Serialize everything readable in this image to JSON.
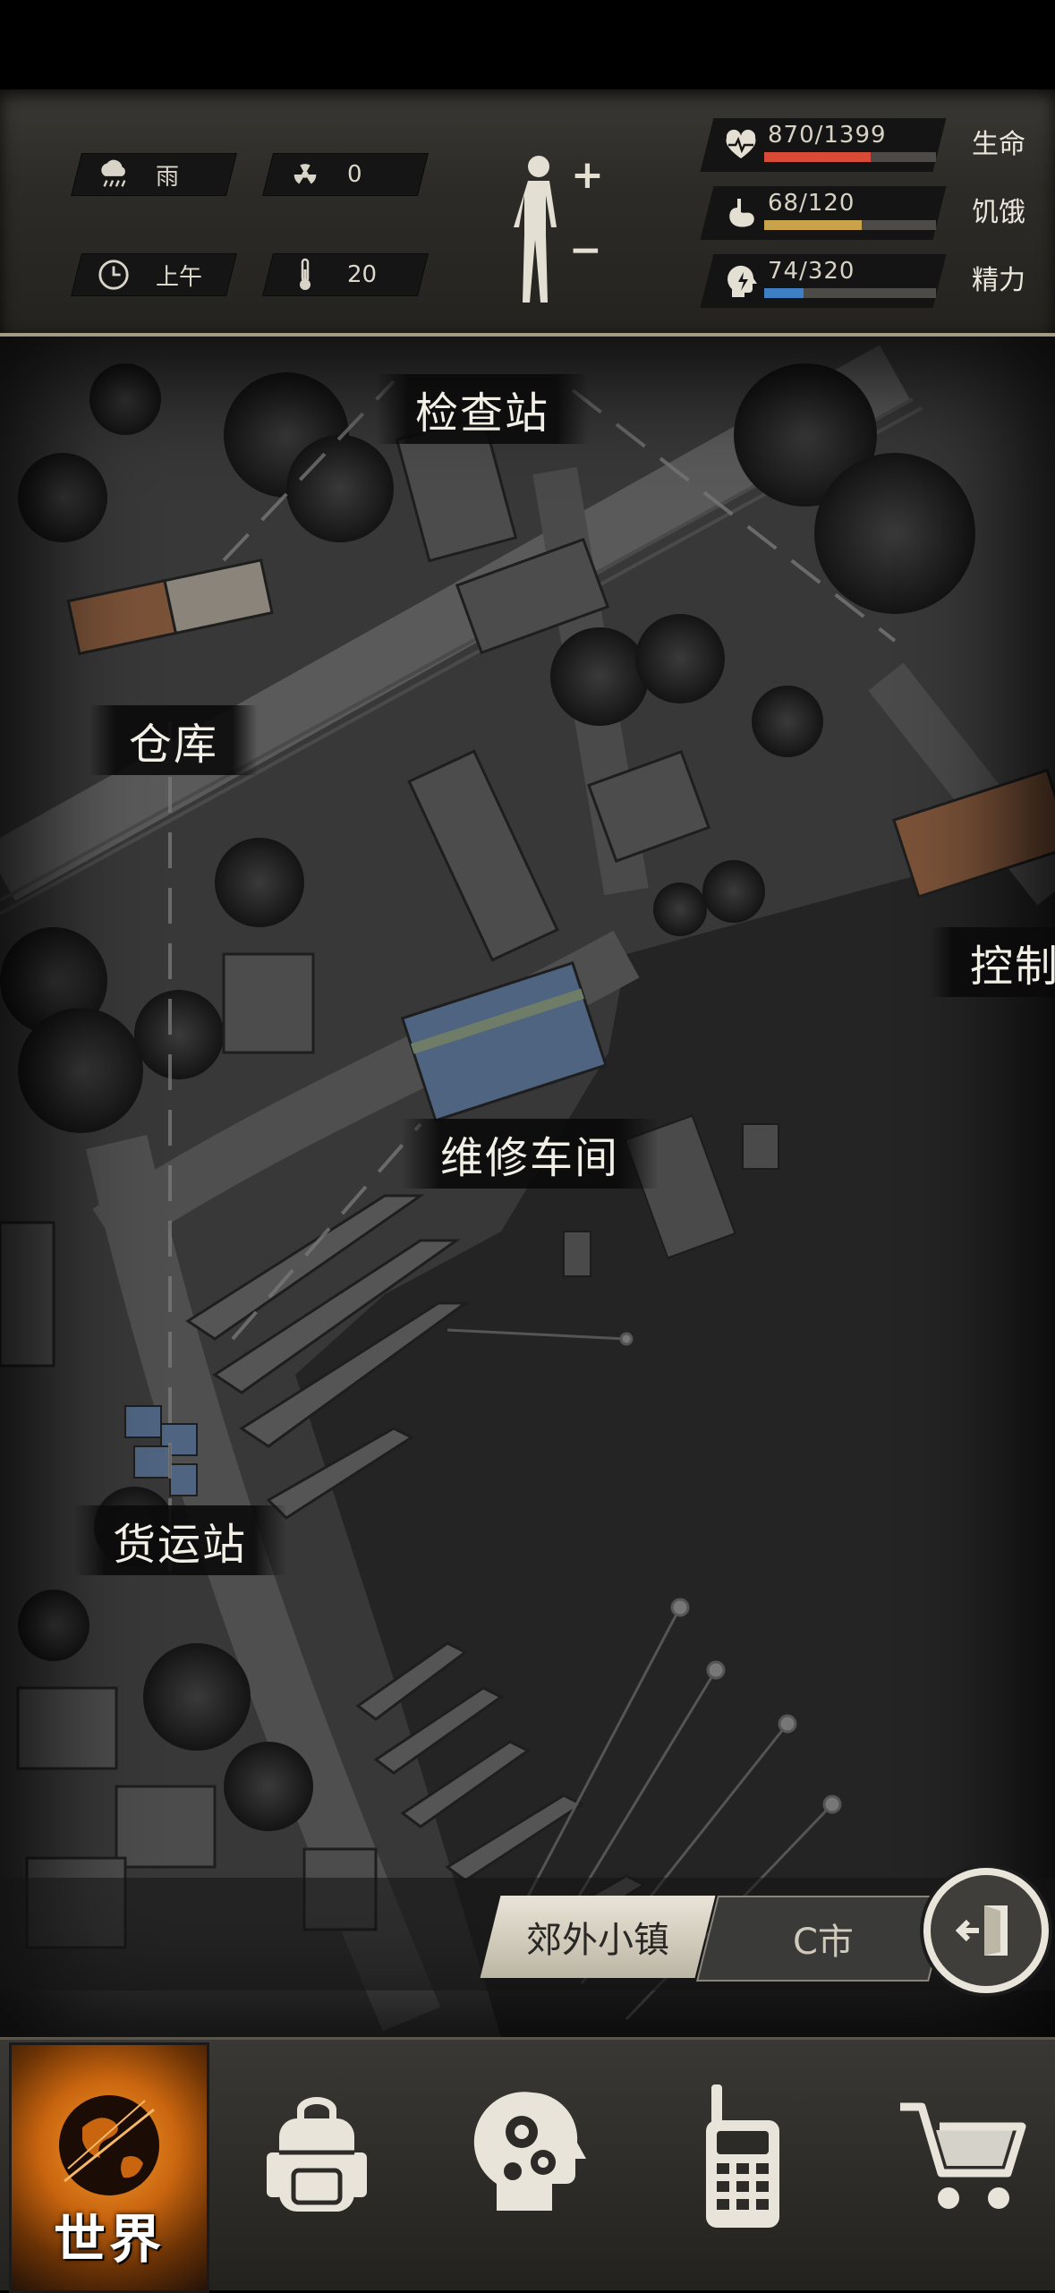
{
  "hud": {
    "weather": {
      "icon": "rain-cloud-icon",
      "label": "雨"
    },
    "radiation": {
      "icon": "radiation-icon",
      "value": "0"
    },
    "time": {
      "icon": "clock-icon",
      "label": "上午"
    },
    "temperature": {
      "icon": "thermometer-icon",
      "value": "20"
    },
    "body_controls": {
      "plus": "+",
      "minus": "−"
    },
    "stats": [
      {
        "name": "health",
        "icon": "heart-pulse-icon",
        "value": "870/1399",
        "label": "生命",
        "current": 870,
        "max": 1399,
        "color": "#d94a37"
      },
      {
        "name": "hunger",
        "icon": "stomach-icon",
        "value": "68/120",
        "label": "饥饿",
        "current": 68,
        "max": 120,
        "color": "#c9a34a"
      },
      {
        "name": "energy",
        "icon": "head-bolt-icon",
        "value": "74/320",
        "label": "精力",
        "current": 74,
        "max": 320,
        "color": "#3f7fc6"
      }
    ]
  },
  "map": {
    "locations": [
      {
        "id": "checkpoint",
        "label": "检查站"
      },
      {
        "id": "warehouse",
        "label": "仓库"
      },
      {
        "id": "control",
        "label": "控制"
      },
      {
        "id": "repair-workshop",
        "label": "维修车间"
      },
      {
        "id": "freight-station",
        "label": "货运站"
      }
    ]
  },
  "regions": {
    "tabs": [
      {
        "label": "郊外小镇",
        "active": true
      },
      {
        "label": "C市",
        "active": false
      }
    ],
    "exit_icon": "exit-door-icon"
  },
  "nav": [
    {
      "id": "world",
      "label": "世界",
      "icon": "globe-icon",
      "active": true
    },
    {
      "id": "backpack",
      "icon": "backpack-icon"
    },
    {
      "id": "skills",
      "icon": "head-gears-icon"
    },
    {
      "id": "radio",
      "icon": "walkie-talkie-icon"
    },
    {
      "id": "shop",
      "icon": "shopping-cart-icon"
    }
  ]
}
